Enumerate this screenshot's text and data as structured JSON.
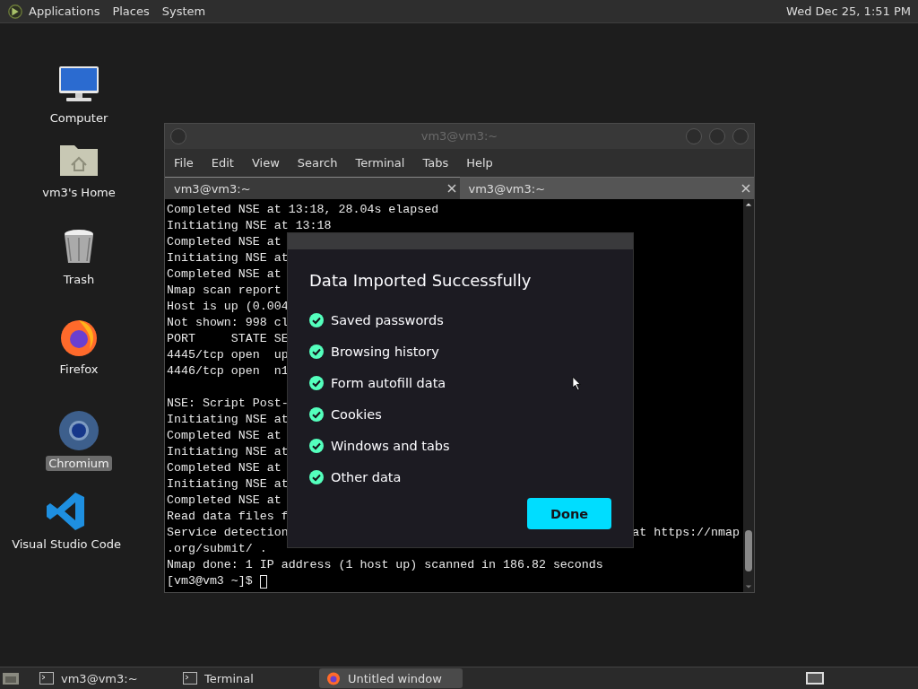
{
  "top_panel": {
    "menus": [
      "Applications",
      "Places",
      "System"
    ],
    "clock": "Wed Dec 25,  1:51 PM"
  },
  "desktop_icons": [
    {
      "kind": "computer",
      "label": "Computer",
      "selected": false
    },
    {
      "kind": "home",
      "label": "vm3's Home",
      "selected": false
    },
    {
      "kind": "trash",
      "label": "Trash",
      "selected": false
    },
    {
      "kind": "firefox",
      "label": "Firefox",
      "selected": false
    },
    {
      "kind": "chromium",
      "label": "Chromium",
      "selected": true
    },
    {
      "kind": "vscode",
      "label": "Visual Studio Code",
      "selected": false
    }
  ],
  "terminal_window": {
    "title": "vm3@vm3:~",
    "menus": [
      "File",
      "Edit",
      "View",
      "Search",
      "Terminal",
      "Tabs",
      "Help"
    ],
    "tabs": [
      {
        "label": "vm3@vm3:~",
        "selected": true
      },
      {
        "label": "vm3@vm3:~",
        "selected": false
      }
    ],
    "output_blocks": [
      {
        "lines": [
          {
            "text": "Completed NSE at 13:18, 28.04s elapsed"
          },
          {
            "text": "Initiating NSE at 13:18"
          },
          {
            "text": "Completed NSE at"
          },
          {
            "text": "Initiating NSE at"
          },
          {
            "text": "Completed NSE at"
          },
          {
            "text": "Nmap scan report"
          },
          {
            "text": "Host is up (0.004"
          },
          {
            "text": "Not shown: 998 cl"
          },
          {
            "text": "PORT     STATE SE"
          },
          {
            "text": "4445/tcp open  up"
          },
          {
            "text": "4446/tcp open  n1"
          }
        ]
      },
      {
        "lines": [
          {
            "text": "NSE: Script Post-"
          },
          {
            "text": "Initiating NSE at"
          },
          {
            "text": "Completed NSE at"
          },
          {
            "text": "Initiating NSE at"
          },
          {
            "text": "Completed NSE at"
          },
          {
            "text": "Initiating NSE at"
          },
          {
            "text": "Completed NSE at"
          },
          {
            "text": "Read data files f"
          },
          {
            "text": "Service detection",
            "right": "at https://nmap"
          },
          {
            "text": ".org/submit/ ."
          },
          {
            "text": "Nmap done: 1 IP address (1 host up) scanned in 186.82 seconds"
          },
          {
            "text": "[vm3@vm3 ~]$ ",
            "cursor": true
          }
        ]
      }
    ]
  },
  "dialog": {
    "title": "Data Imported Successfully",
    "items": [
      {
        "label": "Saved passwords",
        "imported": true
      },
      {
        "label": "Browsing history",
        "imported": true
      },
      {
        "label": "Form autofill data",
        "imported": true
      },
      {
        "label": "Cookies",
        "imported": true
      },
      {
        "label": "Windows and tabs",
        "imported": true
      },
      {
        "label": "Other data",
        "imported": true
      }
    ],
    "button": "Done"
  },
  "taskbar": {
    "items": [
      {
        "kind": "terminal",
        "label": "vm3@vm3:~",
        "selected": false
      },
      {
        "kind": "terminal",
        "label": "Terminal",
        "selected": false
      },
      {
        "kind": "firefox",
        "label": "Untitled window",
        "selected": true
      }
    ]
  }
}
